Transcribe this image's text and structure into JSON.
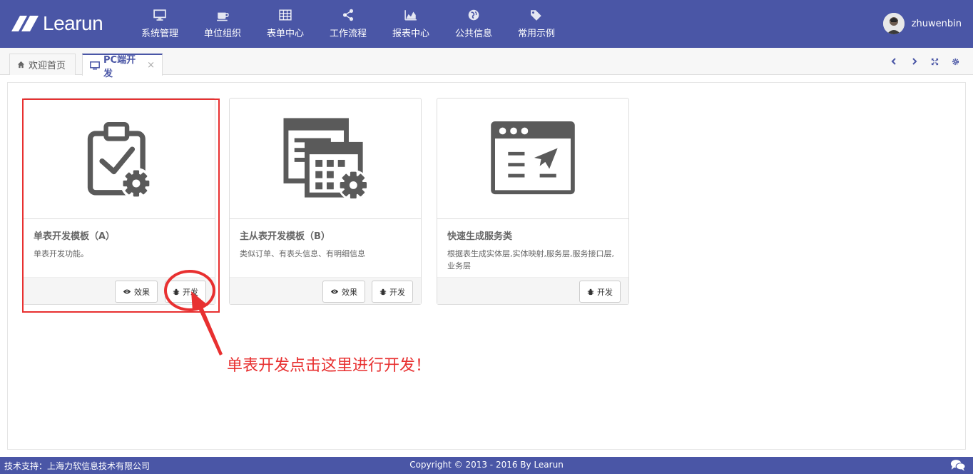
{
  "header": {
    "logo_text": "Learun",
    "nav": [
      {
        "label": "系统管理",
        "icon": "monitor-icon"
      },
      {
        "label": "单位组织",
        "icon": "coffee-icon"
      },
      {
        "label": "表单中心",
        "icon": "table-icon"
      },
      {
        "label": "工作流程",
        "icon": "share-icon"
      },
      {
        "label": "报表中心",
        "icon": "area-chart-icon"
      },
      {
        "label": "公共信息",
        "icon": "globe-icon"
      },
      {
        "label": "常用示例",
        "icon": "tags-icon"
      }
    ],
    "username": "zhuwenbin"
  },
  "tabs": [
    {
      "label": "欢迎首页",
      "icon": "home-icon",
      "active": false
    },
    {
      "label": "PC端开发",
      "icon": "desktop-icon",
      "active": true,
      "close": "×"
    }
  ],
  "cards": [
    {
      "title": "单表开发模板（A）",
      "desc": "单表开发功能。",
      "buttons": {
        "effect": "效果",
        "develop": "开发"
      }
    },
    {
      "title": "主从表开发模板（B）",
      "desc": "类似订单、有表头信息、有明细信息",
      "buttons": {
        "effect": "效果",
        "develop": "开发"
      }
    },
    {
      "title": "快速生成服务类",
      "desc": "根据表生成实体层,实体映射,服务层,服务接口层,业务层",
      "buttons": {
        "develop": "开发"
      }
    }
  ],
  "annotation": {
    "text": "单表开发点击这里进行开发！"
  },
  "footer": {
    "left": "技术支持：上海力软信息技术有限公司",
    "center": "Copyright © 2013 - 2016 By Learun"
  },
  "colors": {
    "primary": "#4a56a6",
    "annotation": "#e83030",
    "icon_gray": "#555555"
  }
}
